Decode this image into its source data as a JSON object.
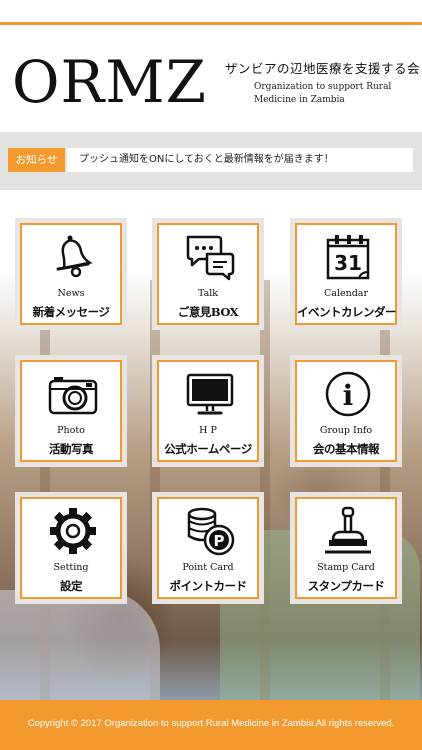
{
  "header": {
    "logo": "ORMZ",
    "tagline_jp": "ザンビアの辺地医療を支援する会",
    "tagline_en": "Organization to support Rural Medicine in Zambia"
  },
  "notice": {
    "tag": "お知らせ",
    "text": "プッシュ通知をONにしておくと最新情報をが届きます！"
  },
  "menu": [
    {
      "en": "News",
      "jp": "新着メッセージ",
      "icon": "bell-icon"
    },
    {
      "en": "Talk",
      "jp": "ご意見BOX",
      "icon": "speech-bubbles-icon"
    },
    {
      "en": "Calendar",
      "jp": "イベントカレンダー",
      "icon": "calendar-icon",
      "icon_text": "31"
    },
    {
      "en": "Photo",
      "jp": "活動写真",
      "icon": "camera-icon"
    },
    {
      "en": "H P",
      "jp": "公式ホームページ",
      "icon": "monitor-icon"
    },
    {
      "en": "Group Info",
      "jp": "会の基本情報",
      "icon": "info-icon",
      "icon_text": "i"
    },
    {
      "en": "Setting",
      "jp": "設定",
      "icon": "gear-icon"
    },
    {
      "en": "Point Card",
      "jp": "ポイントカード",
      "icon": "coins-icon",
      "icon_text": "P"
    },
    {
      "en": "Stamp Card",
      "jp": "スタンプカード",
      "icon": "stamp-icon"
    }
  ],
  "footer": {
    "text": "Copyright © 2017 Organization to support Rural Medicine in Zambia All rights reserved."
  },
  "colors": {
    "accent": "#f29a2e",
    "tile_bg": "#e6e5e3",
    "notice_bar": "#e3e2e0"
  }
}
